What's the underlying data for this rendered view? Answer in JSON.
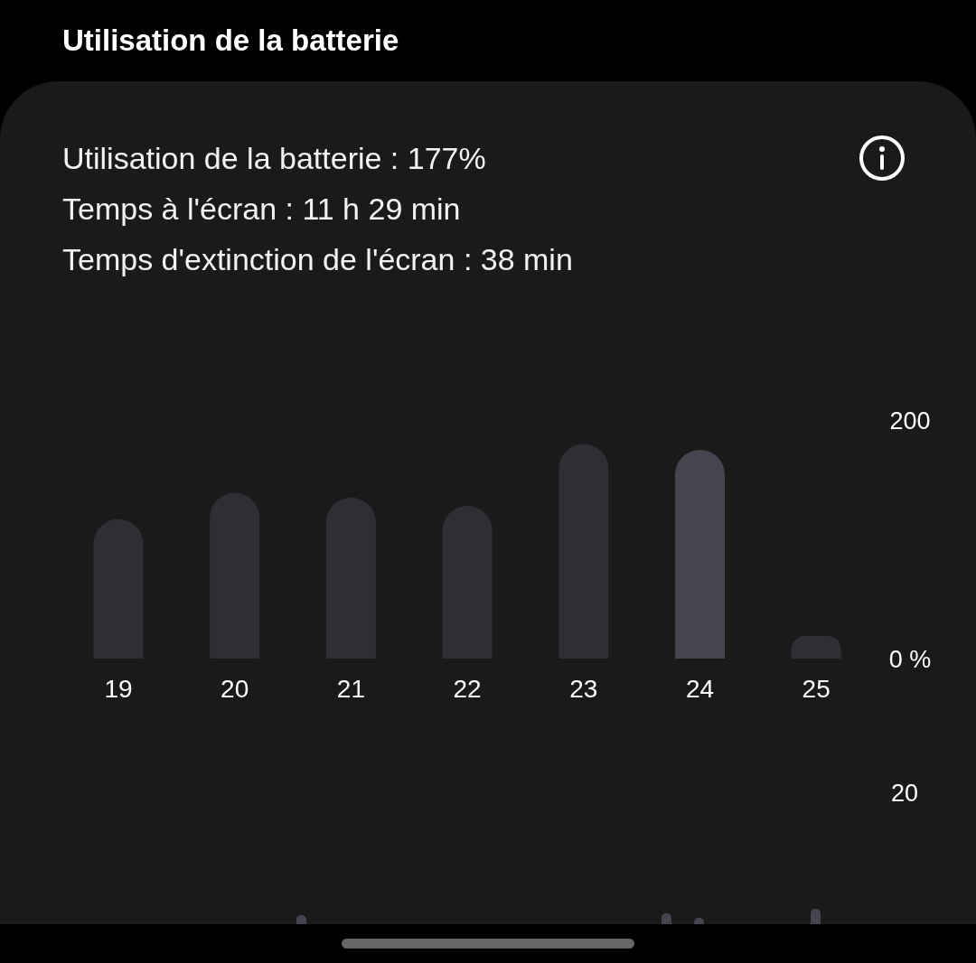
{
  "header": {
    "title": "Utilisation de la batterie"
  },
  "summary": [
    "Utilisation de la batterie : 177%",
    "Temps à l'écran : 11 h 29 min",
    "Temps d'extinction de l'écran : 38 min"
  ],
  "chart": {
    "chart_data": {
      "type": "bar",
      "categories": [
        "19",
        "20",
        "21",
        "22",
        "23",
        "24",
        "25"
      ],
      "values": [
        117,
        139,
        135,
        128,
        180,
        175,
        19
      ],
      "ylim": [
        0,
        200
      ],
      "yticks": [
        {
          "value": 200,
          "label": "200"
        },
        {
          "value": 0,
          "label": "0 %"
        }
      ]
    },
    "bars": [
      {
        "selected": false
      },
      {
        "selected": false
      },
      {
        "selected": false
      },
      {
        "selected": false
      },
      {
        "selected": false
      },
      {
        "selected": true
      },
      {
        "selected": false
      }
    ]
  },
  "second_chart": {
    "y_label": "20"
  }
}
